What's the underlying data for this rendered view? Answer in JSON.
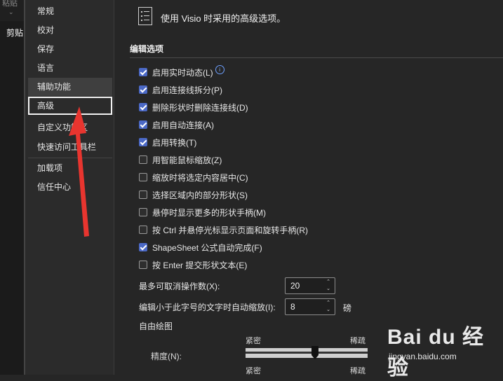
{
  "ribbon": {
    "paste_label": "粘贴",
    "clipboard_label": "剪贴"
  },
  "nav": {
    "items": [
      {
        "label": "常规"
      },
      {
        "label": "校对"
      },
      {
        "label": "保存"
      },
      {
        "label": "语言"
      },
      {
        "label": "辅助功能"
      },
      {
        "label": "高级"
      },
      {
        "label": "自定义功能区"
      },
      {
        "label": "快速访问工具栏"
      },
      {
        "label": "加载项"
      },
      {
        "label": "信任中心"
      }
    ],
    "selected": "高级"
  },
  "header": {
    "text": "使用 Visio 时采用的高级选项。"
  },
  "section": {
    "title": "编辑选项"
  },
  "options": [
    {
      "label": "启用实时动态(L)",
      "checked": true,
      "info": true
    },
    {
      "label": "启用连接线拆分(P)",
      "checked": true
    },
    {
      "label": "删除形状时删除连接线(D)",
      "checked": true
    },
    {
      "label": "启用自动连接(A)",
      "checked": true
    },
    {
      "label": "启用转换(T)",
      "checked": true
    },
    {
      "label": "用智能鼠标缩放(Z)",
      "checked": false
    },
    {
      "label": "缩放时将选定内容居中(C)",
      "checked": false
    },
    {
      "label": "选择区域内的部分形状(S)",
      "checked": false
    },
    {
      "label": "悬停时显示更多的形状手柄(M)",
      "checked": false
    },
    {
      "label": "按 Ctrl 并悬停光标显示页面和旋转手柄(R)",
      "checked": false
    },
    {
      "label": "ShapeSheet 公式自动完成(F)",
      "checked": true
    },
    {
      "label": "按 Enter 提交形状文本(E)",
      "checked": false
    }
  ],
  "undo_field": {
    "label": "最多可取消操作数(X):",
    "value": "20"
  },
  "autozoom_field": {
    "label": "编辑小于此字号的文字时自动缩放(I):",
    "value": "8",
    "unit": "磅"
  },
  "freeform": {
    "title": "自由绘图",
    "precision_label": "精度(N):",
    "left_label": "紧密",
    "right_label": "稀疏",
    "level": 0.57
  },
  "watermark": {
    "logo": "Bai du 经验",
    "url": "jingyan.baidu.com"
  },
  "colors": {
    "accent": "#4b69c6",
    "annotation": "#e8352f"
  }
}
